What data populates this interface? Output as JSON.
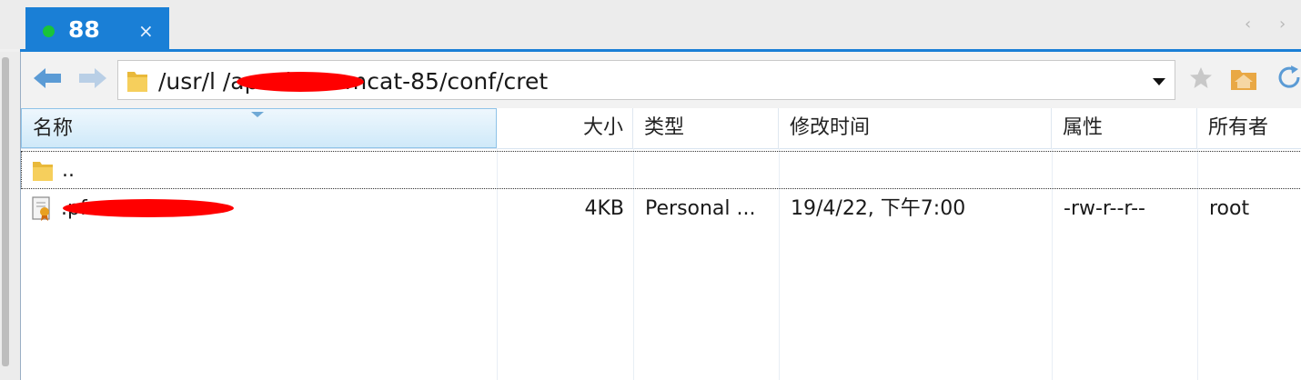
{
  "tab": {
    "label": "88",
    "close_glyph": "×",
    "status_color": "#19c43a"
  },
  "tab_scroll": {
    "left": "‹",
    "right": "›"
  },
  "address": {
    "path": "/usr/l           /apache-tomcat-85/conf/cret"
  },
  "icons": {
    "back": "back-arrow-icon",
    "forward": "forward-arrow-icon",
    "folder": "folder-icon",
    "star": "star-icon",
    "home": "home-folder-icon",
    "refresh": "refresh-icon"
  },
  "columns": [
    "名称",
    "大小",
    "类型",
    "修改时间",
    "属性",
    "所有者"
  ],
  "rows": [
    {
      "name": "..",
      "size": "",
      "type": "",
      "modified": "",
      "attrs": "",
      "owner": ""
    },
    {
      "name": "                    .pfx",
      "size": "4KB",
      "type": "Personal ...",
      "modified": "19/4/22, 下午7:00",
      "attrs": "-rw-r--r--",
      "owner": "root"
    }
  ],
  "colors": {
    "accent": "#1a7fd6",
    "redaction": "#ff0000"
  }
}
